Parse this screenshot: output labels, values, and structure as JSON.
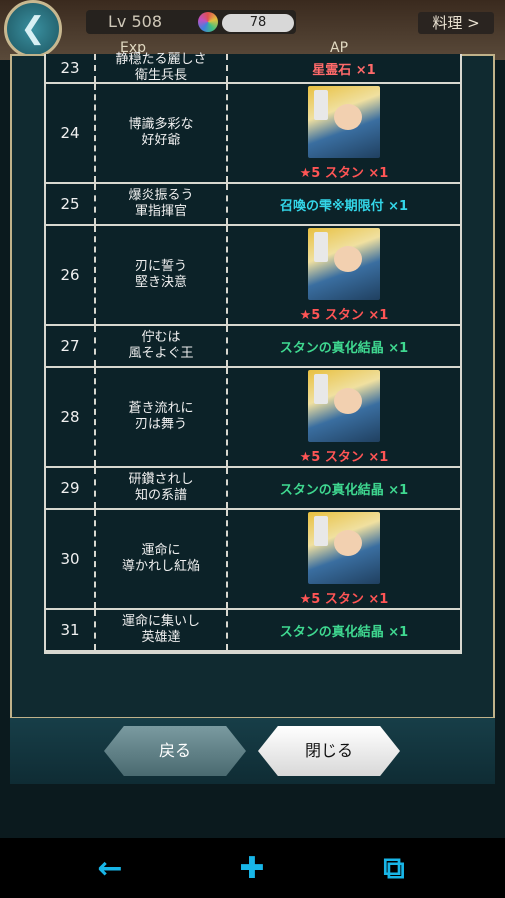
{
  "header": {
    "back_icon": "back-arrow-icon",
    "level_label": "Lv 508",
    "gem_count": "78",
    "cooking_label": "料理 >",
    "exp_label": "Exp",
    "ap_label": "AP"
  },
  "rows": [
    {
      "num": "23",
      "name": "静穏たる麗しさ\n衛生兵長",
      "reward": "星霊石 ×1",
      "reward_color": "#ff6a6a",
      "has_portrait": false
    },
    {
      "num": "24",
      "name": "博識多彩な\n好好爺",
      "reward": "★5 スタン ×1",
      "reward_color": "#ff5555",
      "has_portrait": true
    },
    {
      "num": "25",
      "name": "爆炎振るう\n軍指揮官",
      "reward": "召喚の雫※期限付 ×1",
      "reward_color": "#33d6e8",
      "has_portrait": false
    },
    {
      "num": "26",
      "name": "刃に誓う\n堅き決意",
      "reward": "★5 スタン ×1",
      "reward_color": "#ff5555",
      "has_portrait": true
    },
    {
      "num": "27",
      "name": "佇むは\n風そよぐ王",
      "reward": "スタンの真化結晶 ×1",
      "reward_color": "#3fd890",
      "has_portrait": false
    },
    {
      "num": "28",
      "name": "蒼き流れに\n刃は舞う",
      "reward": "★5 スタン ×1",
      "reward_color": "#ff5555",
      "has_portrait": true
    },
    {
      "num": "29",
      "name": "研鑽されし\n知の系譜",
      "reward": "スタンの真化結晶 ×1",
      "reward_color": "#3fd890",
      "has_portrait": false
    },
    {
      "num": "30",
      "name": "運命に\n導かれし紅焔",
      "reward": "★5 スタン ×1",
      "reward_color": "#ff5555",
      "has_portrait": true
    },
    {
      "num": "31",
      "name": "運命に集いし\n英雄達",
      "reward": "スタンの真化結晶 ×1",
      "reward_color": "#3fd890",
      "has_portrait": false
    }
  ],
  "buttons": {
    "back_label": "戻る",
    "close_label": "閉じる"
  },
  "nav": {
    "left_icon": "nav-back-icon",
    "home_icon": "nav-home-icon",
    "recent_icon": "nav-recent-icon"
  }
}
